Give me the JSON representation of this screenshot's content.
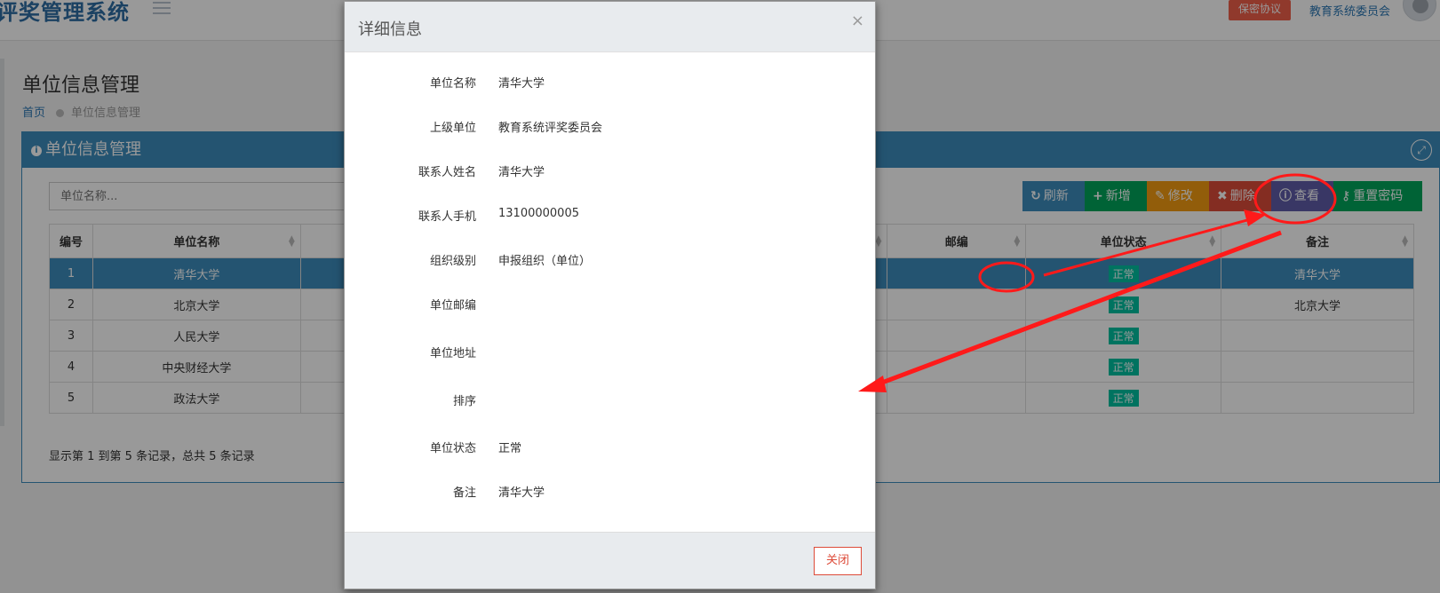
{
  "header": {
    "brand": "评奖管理系统",
    "secret_label": "保密协议",
    "user_name": "教育系统委员会"
  },
  "page": {
    "title": "单位信息管理",
    "breadcrumb_home": "首页",
    "breadcrumb_current": "单位信息管理"
  },
  "panel": {
    "title": "单位信息管理",
    "search_placeholder": "单位名称..."
  },
  "toolbar": {
    "refresh": "刷新",
    "add": "新增",
    "edit": "修改",
    "delete": "删除",
    "view": "查看",
    "reset_password": "重置密码"
  },
  "table": {
    "headers": [
      "编号",
      "单位名称",
      "邮编",
      "单位状态",
      "备注"
    ],
    "rows": [
      {
        "id": "1",
        "name": "清华大学",
        "postcode": "",
        "status": "正常",
        "remark": "清华大学"
      },
      {
        "id": "2",
        "name": "北京大学",
        "postcode": "",
        "status": "正常",
        "remark": "北京大学"
      },
      {
        "id": "3",
        "name": "人民大学",
        "postcode": "",
        "status": "正常",
        "remark": ""
      },
      {
        "id": "4",
        "name": "中央财经大学",
        "postcode": "",
        "status": "正常",
        "remark": ""
      },
      {
        "id": "5",
        "name": "政法大学",
        "postcode": "",
        "status": "正常",
        "remark": ""
      }
    ],
    "footer": "显示第 1 到第 5 条记录，总共 5 条记录"
  },
  "modal": {
    "title": "详细信息",
    "close_x": "×",
    "fields": [
      {
        "label": "单位名称",
        "value": "清华大学"
      },
      {
        "label": "上级单位",
        "value": "教育系统评奖委员会"
      },
      {
        "label": "联系人姓名",
        "value": "清华大学"
      },
      {
        "label": "联系人手机",
        "value": "13100000005"
      },
      {
        "label": "组织级别",
        "value": "申报组织（单位）"
      },
      {
        "label": "单位邮编",
        "value": ""
      },
      {
        "label": "单位地址",
        "value": ""
      },
      {
        "label": "排序",
        "value": ""
      },
      {
        "label": "单位状态",
        "value": "正常"
      },
      {
        "label": "备注",
        "value": "清华大学"
      }
    ],
    "close_button": "关闭"
  },
  "colors": {
    "primary": "#3c8dbc",
    "annotation": "#ff1a1a"
  }
}
